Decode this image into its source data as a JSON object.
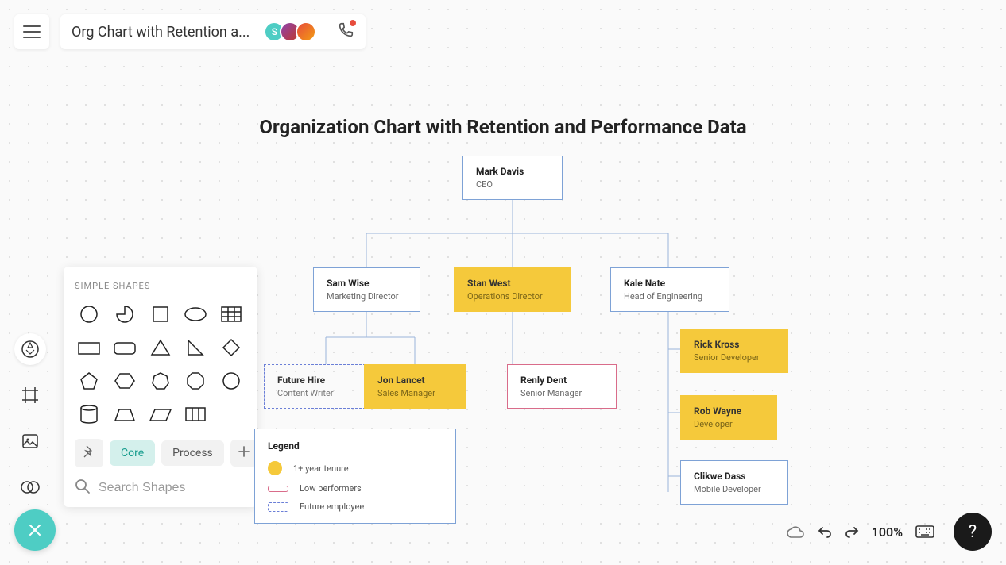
{
  "header": {
    "doc_title": "Org Chart with Retention a...",
    "avatars": [
      {
        "bg": "#4ecdc4",
        "initial": "S"
      },
      {
        "bg": "#8e44ad",
        "initial": ""
      },
      {
        "bg": "#c0392b",
        "initial": ""
      }
    ]
  },
  "canvas": {
    "title": "Organization Chart with Retention and Performance Data",
    "nodes": {
      "ceo": {
        "name": "Mark Davis",
        "role": "CEO"
      },
      "mkt": {
        "name": "Sam Wise",
        "role": "Marketing Director"
      },
      "ops": {
        "name": "Stan West",
        "role": "Operations Director"
      },
      "eng": {
        "name": "Kale Nate",
        "role": "Head of Engineering"
      },
      "future": {
        "name": "Future Hire",
        "role": "Content Writer"
      },
      "sales": {
        "name": "Jon Lancet",
        "role": "Sales Manager"
      },
      "srmgr": {
        "name": "Renly Dent",
        "role": "Senior Manager"
      },
      "rick": {
        "name": "Rick Kross",
        "role": "Senior Developer"
      },
      "rob": {
        "name": "Rob Wayne",
        "role": "Developer"
      },
      "clikwe": {
        "name": "Clikwe Dass",
        "role": "Mobile Developer"
      }
    },
    "legend": {
      "title": "Legend",
      "tenure": "1+ year tenure",
      "low": "Low performers",
      "future": "Future employee"
    }
  },
  "shapes_panel": {
    "header": "SIMPLE SHAPES",
    "tabs": {
      "core": "Core",
      "process": "Process"
    },
    "search_placeholder": "Search Shapes"
  },
  "footer": {
    "zoom": "100%"
  }
}
